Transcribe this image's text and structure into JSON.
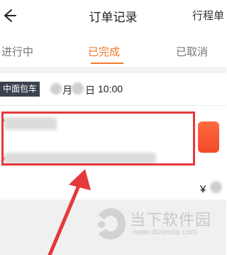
{
  "header": {
    "title": "订单记录",
    "right_action": "行程单",
    "back_icon": "back-arrow-icon"
  },
  "tabs": [
    {
      "label": "进行中",
      "active": false
    },
    {
      "label": "已完成",
      "active": true
    },
    {
      "label": "已取消",
      "active": false
    }
  ],
  "colors": {
    "accent": "#f07a2b",
    "highlight": "#e5383b",
    "badge_bg": "#3c4350",
    "status_chip": "#f2492a"
  },
  "order": {
    "vehicle_badge": "中面包车",
    "month_suffix": "月",
    "day_suffix": "日",
    "time": "10:00",
    "price_prefix": "¥"
  },
  "watermark": {
    "name": "当下软件园",
    "url": "www.downxia.com"
  }
}
